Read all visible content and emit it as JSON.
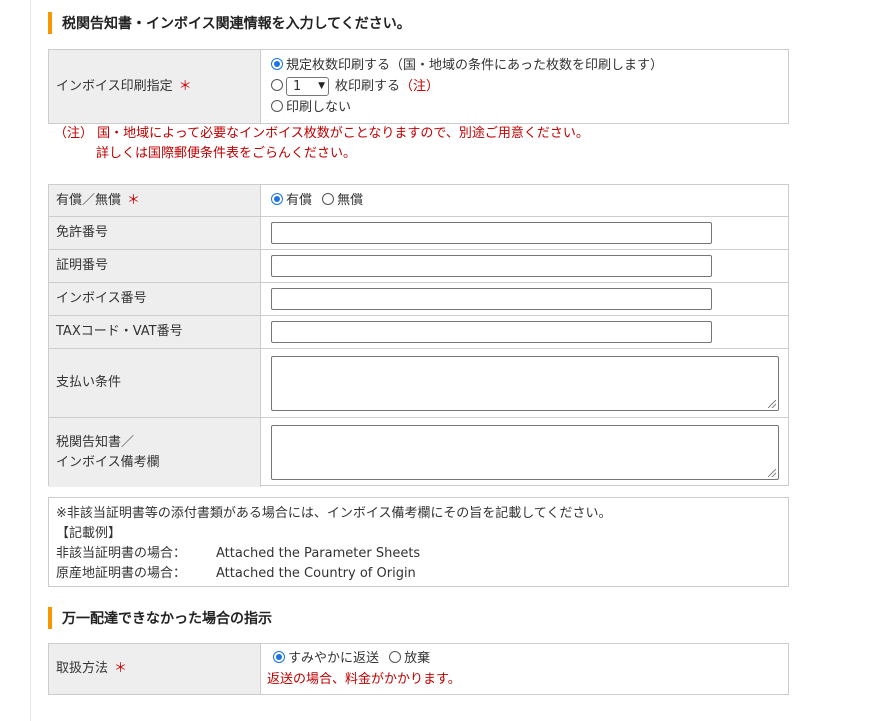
{
  "section1": {
    "title": "税関告知書・インボイス関連情報を入力してください。"
  },
  "invoice_print": {
    "label": "インボイス印刷指定",
    "required_mark": "＊",
    "option1": "規定枚数印刷する（国・地域の条件にあった枚数を印刷します）",
    "select_value": "1",
    "option2": "枚印刷する",
    "option2_note": "（注）",
    "option3": "印刷しない",
    "selected": "option1"
  },
  "note": {
    "prefix": "（注）",
    "line1": "国・地域によって必要なインボイス枚数がことなりますので、別途ご用意ください。",
    "line2": "詳しくは国際郵便条件表をごらんください。"
  },
  "fields": {
    "paid": {
      "label": "有償／無償",
      "required_mark": "＊",
      "opt_paid": "有償",
      "opt_free": "無償",
      "selected": "有償"
    },
    "license": {
      "label": "免許番号",
      "value": ""
    },
    "certificate": {
      "label": "証明番号",
      "value": ""
    },
    "invoice_no": {
      "label": "インボイス番号",
      "value": ""
    },
    "tax_code": {
      "label": "TAXコード・VAT番号",
      "value": ""
    },
    "payment": {
      "label": "支払い条件",
      "value": ""
    },
    "remarks": {
      "label_line1": "税関告知書／",
      "label_line2": "インボイス備考欄",
      "value": ""
    }
  },
  "info": {
    "line1": "※非該当証明書等の添付書類がある場合には、インボイス備考欄にその旨を記載してください。",
    "line2": "【記載例】",
    "line3_label": "非該当証明書の場合：",
    "line3_value": "Attached the Parameter Sheets",
    "line4_label": "原産地証明書の場合：",
    "line4_value": "Attached the Country of Origin"
  },
  "section2": {
    "title": "万一配達できなかった場合の指示"
  },
  "handling": {
    "label": "取扱方法",
    "required_mark": "＊",
    "opt_return": "すみやかに返送",
    "opt_abandon": "放棄",
    "selected": "すみやかに返送",
    "note": "返送の場合、料金がかかります。"
  },
  "colors": {
    "accent": "#f39800",
    "required": "#cc0000",
    "note": "#c00000",
    "radio": "#1a73e8"
  }
}
